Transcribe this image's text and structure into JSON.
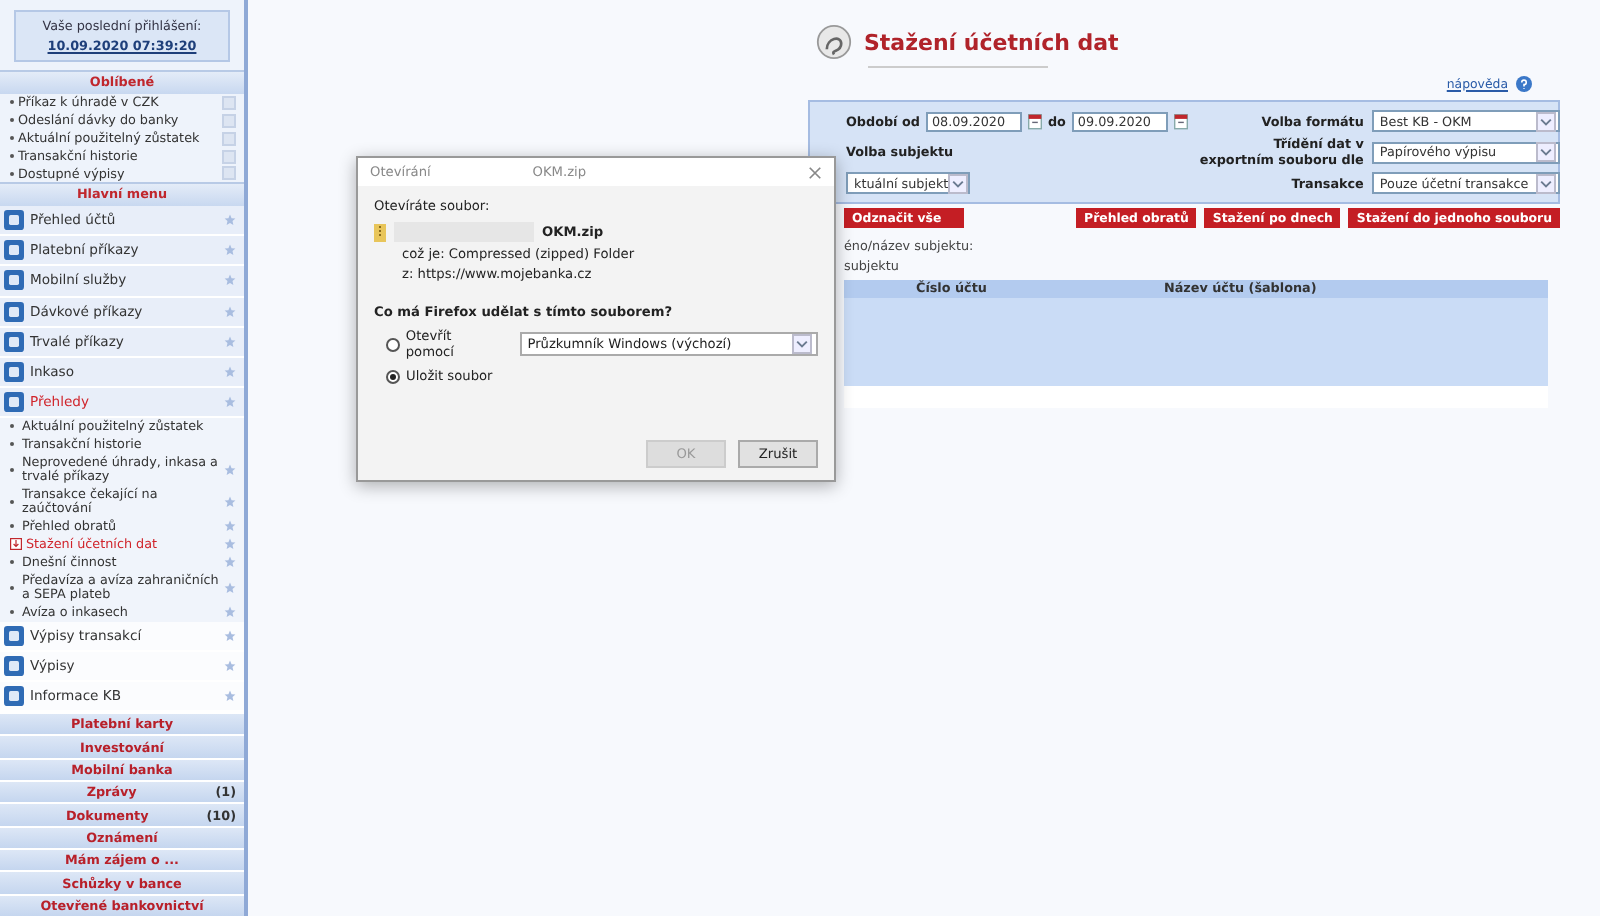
{
  "sidebar": {
    "login": {
      "label": "Vaše poslední přihlášení:",
      "datetime": "10.09.2020 07:39:20"
    },
    "favorites": {
      "title": "Oblíbené",
      "items": [
        "Příkaz k úhradě v CZK",
        "Odeslání dávky do banky",
        "Aktuální použitelný zůstatek",
        "Transakční historie",
        "Dostupné výpisy"
      ]
    },
    "main_menu": {
      "title": "Hlavní menu",
      "items": [
        {
          "label": "Přehled účtů",
          "selected": false
        },
        {
          "label": "Platební příkazy",
          "selected": false
        },
        {
          "label": "Mobilní služby",
          "selected": false
        },
        {
          "label": "Dávkové příkazy",
          "selected": false
        },
        {
          "label": "Trvalé příkazy",
          "selected": false
        },
        {
          "label": "Inkaso",
          "selected": false
        },
        {
          "label": "Přehledy",
          "selected": true,
          "children": [
            {
              "label": "Aktuální použitelný zůstatek",
              "selected": false,
              "star": false
            },
            {
              "label": "Transakční historie",
              "selected": false,
              "star": false
            },
            {
              "label": "Neprovedené úhrady, inkasa a trvalé příkazy",
              "selected": false,
              "star": true
            },
            {
              "label": "Transakce čekající na zaúčtování",
              "selected": false,
              "star": true
            },
            {
              "label": "Přehled obratů",
              "selected": false,
              "star": true
            },
            {
              "label": "Stažení účetních dat",
              "selected": true,
              "star": true
            },
            {
              "label": "Dnešní činnost",
              "selected": false,
              "star": true
            },
            {
              "label": "Předavíza a avíza zahraničních a SEPA plateb",
              "selected": false,
              "star": true
            },
            {
              "label": "Avíza o inkasech",
              "selected": false,
              "star": true
            }
          ]
        },
        {
          "label": "Výpisy transakcí",
          "selected": false
        },
        {
          "label": "Výpisy",
          "selected": false
        },
        {
          "label": "Informace KB",
          "selected": false
        }
      ]
    },
    "sections": [
      {
        "label": "Platební karty"
      },
      {
        "label": "Investování"
      },
      {
        "label": "Mobilní banka"
      },
      {
        "label": "Zprávy",
        "count": "(1)"
      },
      {
        "label": "Dokumenty",
        "count": "(10)"
      },
      {
        "label": "Oznámení"
      },
      {
        "label": "Mám zájem o ..."
      },
      {
        "label": "Schůzky v bance"
      },
      {
        "label": "Otevřené bankovnictví"
      }
    ]
  },
  "page": {
    "title": "Stažení účetních dat",
    "help": "nápověda",
    "filter": {
      "date_from_label": "Období od",
      "date_from": "08.09.2020",
      "date_to_label": "do",
      "date_to": "09.09.2020",
      "format_label": "Volba formátu",
      "format": "Best KB - OKM",
      "subject_label": "Volba subjektu",
      "sort_label": "Třídění dat v exportním souboru dle",
      "sort": "Papírového výpisu",
      "subject": "ktuální subjekt",
      "transactions_label": "Transakce",
      "transactions": "Pouze účetní transakce"
    },
    "buttons": [
      "Odznačit vše",
      "Přehled obratů",
      "Stažení po dnech",
      "Stažení do jednoho souboru"
    ],
    "subject_lines": [
      "éno/název subjektu:",
      "subjektu"
    ],
    "table": {
      "columns": [
        "Číslo účtu",
        "Název účtu (šablona)"
      ]
    }
  },
  "dialog": {
    "title": "Otevírání",
    "filename_title": "OKM.zip",
    "intro": "Otevíráte soubor:",
    "file_name": "OKM.zip",
    "type_line": "což je: Compressed (zipped) Folder",
    "source_line": "z: https://www.mojebanka.cz",
    "question": "Co má Firefox udělat s tímto souborem?",
    "options": [
      {
        "label": "Otevřít pomocí",
        "selected": false,
        "app": "Průzkumník Windows (výchozí)"
      },
      {
        "label": "Uložit soubor",
        "selected": true
      }
    ],
    "buttons": [
      {
        "label": "OK",
        "disabled": true
      },
      {
        "label": "Zrušit",
        "disabled": false
      }
    ]
  }
}
